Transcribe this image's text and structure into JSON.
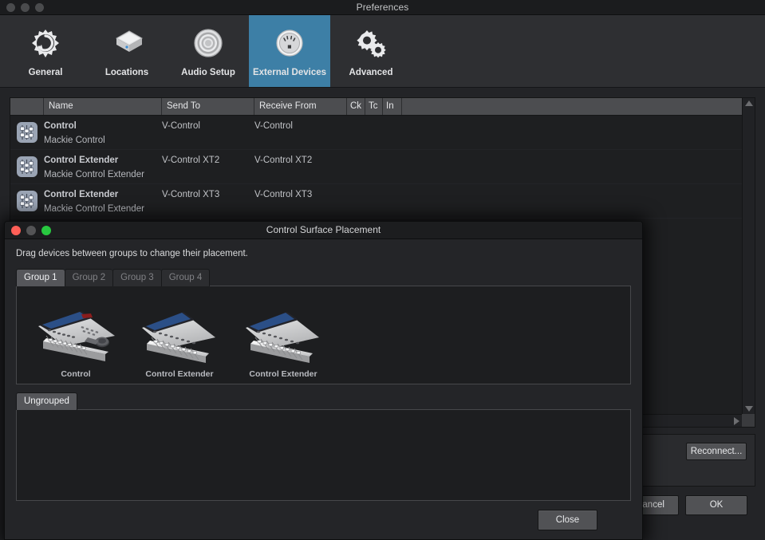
{
  "window": {
    "title": "Preferences",
    "traffic_lights": [
      "close-inactive",
      "minimize-inactive",
      "zoom-inactive"
    ]
  },
  "toolbar": {
    "items": [
      {
        "label": "General",
        "icon": "gear-refresh-icon",
        "selected": false
      },
      {
        "label": "Locations",
        "icon": "hard-drive-icon",
        "selected": false
      },
      {
        "label": "Audio Setup",
        "icon": "speaker-icon",
        "selected": false
      },
      {
        "label": "External Devices",
        "icon": "midi-port-icon",
        "selected": true
      },
      {
        "label": "Advanced",
        "icon": "gears-icon",
        "selected": false
      }
    ],
    "accent_color": "#3d7fa6"
  },
  "device_table": {
    "columns": [
      {
        "key": "icon",
        "label": ""
      },
      {
        "key": "name",
        "label": "Name"
      },
      {
        "key": "send_to",
        "label": "Send To"
      },
      {
        "key": "receive_from",
        "label": "Receive From"
      },
      {
        "key": "ck",
        "label": "Ck"
      },
      {
        "key": "tc",
        "label": "Tc"
      },
      {
        "key": "in",
        "label": "In"
      },
      {
        "key": "rest",
        "label": ""
      }
    ],
    "rows": [
      {
        "icon": "mixer-fader-icon",
        "name": "Control",
        "model": "Mackie Control",
        "send_to": "V-Control",
        "receive_from": "V-Control",
        "ck": "",
        "tc": "",
        "in": ""
      },
      {
        "icon": "mixer-fader-icon",
        "name": "Control Extender",
        "model": "Mackie Control Extender",
        "send_to": "V-Control XT2",
        "receive_from": "V-Control XT2",
        "ck": "",
        "tc": "",
        "in": ""
      },
      {
        "icon": "mixer-fader-icon",
        "name": "Control Extender",
        "model": "Mackie Control Extender",
        "send_to": "V-Control XT3",
        "receive_from": "V-Control XT3",
        "ck": "",
        "tc": "",
        "in": ""
      }
    ]
  },
  "lower_panel": {
    "reconnect_label": "Reconnect..."
  },
  "footer": {
    "cancel_label": "Cancel",
    "ok_label": "OK"
  },
  "dialog": {
    "title": "Control Surface Placement",
    "instruction": "Drag devices between groups to change their placement.",
    "traffic_lights": [
      "close-active",
      "minimize-active",
      "zoom-active"
    ],
    "tabs": [
      {
        "label": "Group 1",
        "active": true
      },
      {
        "label": "Group 2",
        "active": false
      },
      {
        "label": "Group 3",
        "active": false
      },
      {
        "label": "Group 4",
        "active": false
      }
    ],
    "group_devices": [
      {
        "label": "Control",
        "image": "mackie-control-surface"
      },
      {
        "label": "Control Extender",
        "image": "mackie-control-extender"
      },
      {
        "label": "Control Extender",
        "image": "mackie-control-extender"
      }
    ],
    "ungrouped_tab": {
      "label": "Ungrouped",
      "active": true
    },
    "ungrouped_devices": [],
    "close_label": "Close"
  }
}
